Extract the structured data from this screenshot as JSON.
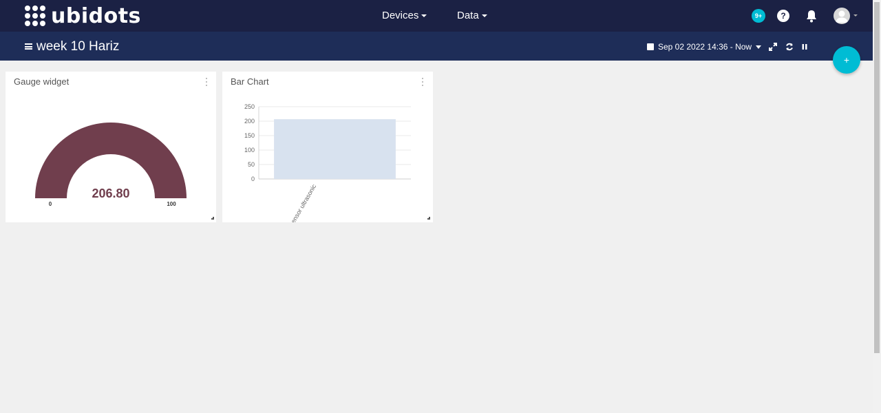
{
  "brand": {
    "name": "ubidots"
  },
  "nav": {
    "devices_label": "Devices",
    "data_label": "Data",
    "notifications_badge": "9+",
    "help_label": "?"
  },
  "dashboard": {
    "title": "week 10 Hariz",
    "date_range": "Sep 02 2022 14:36 - Now",
    "add_label": "+"
  },
  "gauge": {
    "title": "Gauge widget",
    "value_label": "206.80",
    "value": 206.8,
    "min_label": "0",
    "max_label": "100",
    "min": 0,
    "max": 100,
    "fill_color": "#703e4d"
  },
  "bar_widget": {
    "title": "Bar Chart"
  },
  "chart_data": {
    "type": "bar",
    "categories": [
      "sensor ultrasonic"
    ],
    "values": [
      206.8
    ],
    "ylim": [
      0,
      250
    ],
    "yticks": [
      "0",
      "50",
      "100",
      "150",
      "200",
      "250"
    ],
    "bar_color": "#d8e2ef",
    "grid": true
  },
  "colors": {
    "navbar": "#1b2144",
    "subbar": "#1e2d58",
    "accent": "#00bcd4"
  }
}
